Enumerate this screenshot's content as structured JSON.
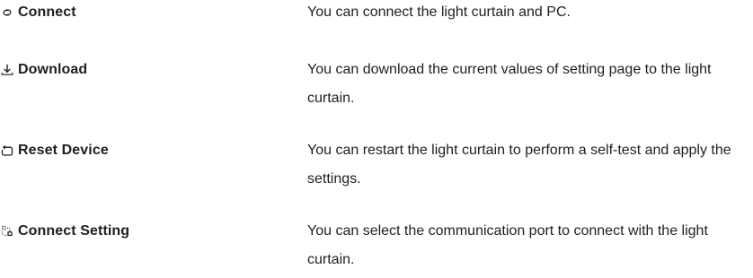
{
  "rows": [
    {
      "icon": "link-icon",
      "term": "Connect",
      "description": "You can connect the light curtain and PC."
    },
    {
      "icon": "download-icon",
      "term": "Download",
      "description": "You can download the current values of setting page to the light curtain."
    },
    {
      "icon": "reset-icon",
      "term": "Reset Device",
      "description": "You can restart the light curtain to perform a self-test and apply the settings."
    },
    {
      "icon": "connect-setting-icon",
      "term": "Connect Setting",
      "description": "You can select the communication port to connect with the light curtain."
    }
  ]
}
